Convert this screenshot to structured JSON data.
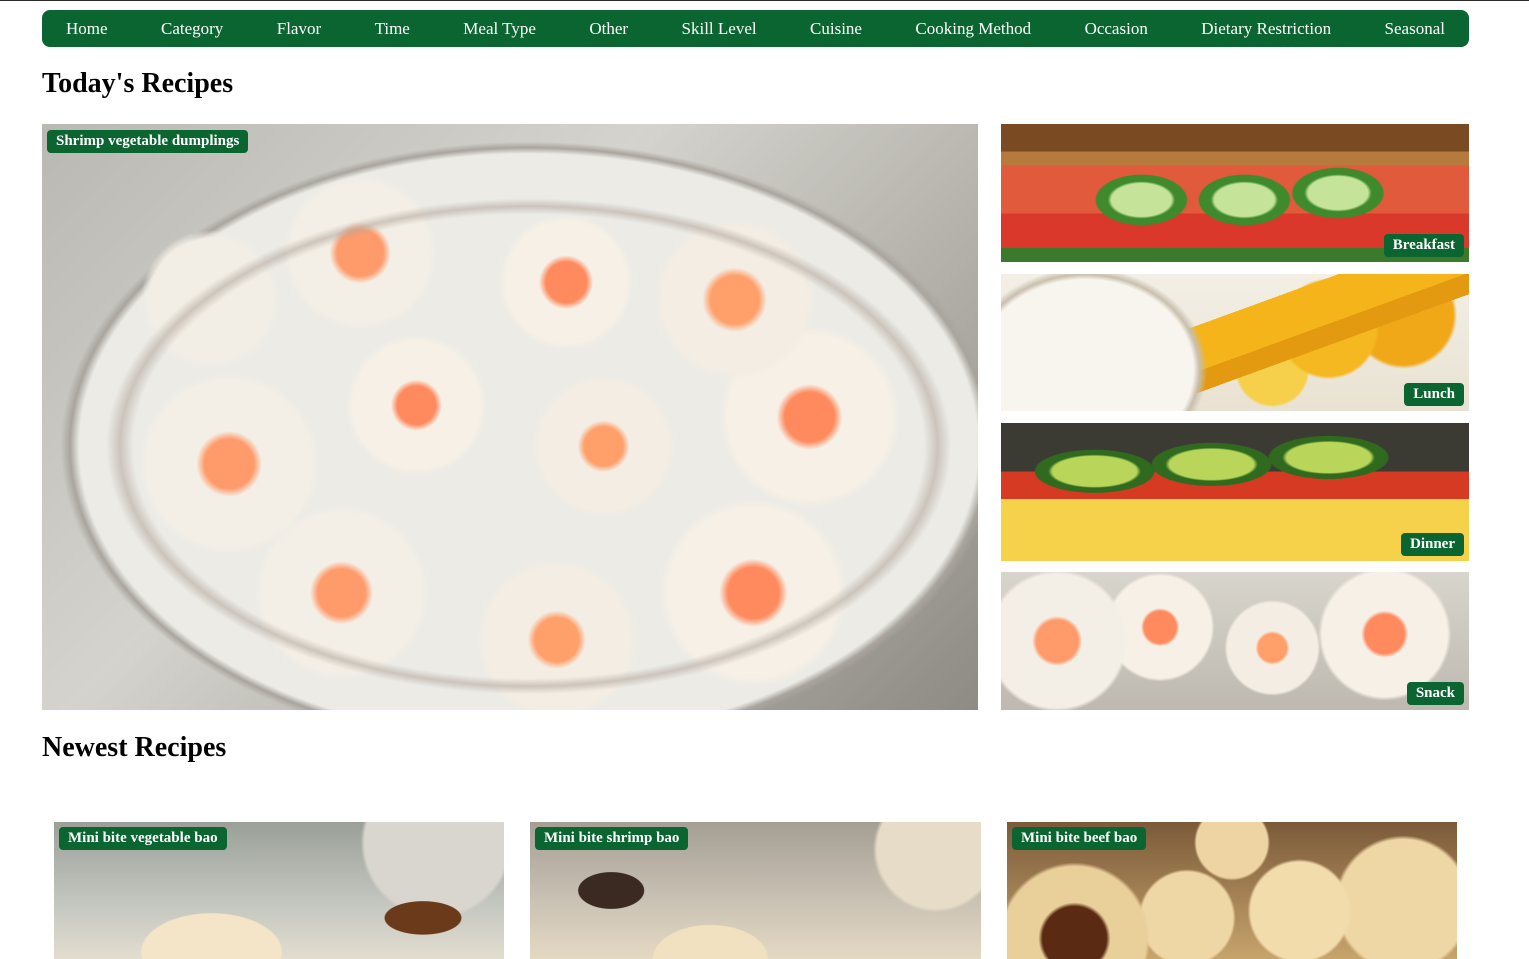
{
  "nav": {
    "items": [
      "Home",
      "Category",
      "Flavor",
      "Time",
      "Meal Type",
      "Other",
      "Skill Level",
      "Cuisine",
      "Cooking Method",
      "Occasion",
      "Dietary Restriction",
      "Seasonal"
    ]
  },
  "today": {
    "heading": "Today's Recipes",
    "featured": {
      "label": "Shrimp vegetable dumplings"
    },
    "side": [
      {
        "label": "Breakfast"
      },
      {
        "label": "Lunch"
      },
      {
        "label": "Dinner"
      },
      {
        "label": "Snack"
      }
    ]
  },
  "newest": {
    "heading": "Newest Recipes",
    "cards": [
      {
        "label": "Mini bite vegetable bao"
      },
      {
        "label": "Mini bite shrimp bao"
      },
      {
        "label": "Mini bite beef bao"
      }
    ]
  },
  "colors": {
    "brand_green": "#0a6530",
    "background": "#ffffff"
  }
}
